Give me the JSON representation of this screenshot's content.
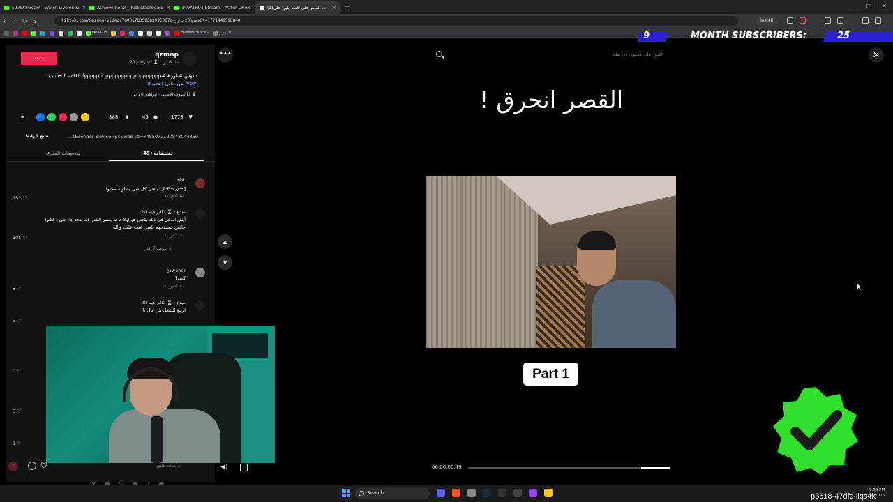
{
  "browser": {
    "tabs": [
      {
        "label": "527W Stream - Watch Live on Ki",
        "favicon_color": "#53fc18",
        "active": false
      },
      {
        "label": "Achievements - Kick Dashboard",
        "favicon_color": "#53fc18",
        "active": false
      },
      {
        "label": "iMUATH94 Stream - Watch Live o",
        "favicon_color": "#53fc18",
        "active": false
      },
      {
        "label": "(1)القصر علي 'قصر باور' علي ...",
        "favicon_color": "#ffffff",
        "active": true
      }
    ],
    "url": "tiktok.com/@qzmnp/video/7608178359683996367q=قصر%20باور&t=1771440598840",
    "install_label": "Install",
    "bookmarks": [
      "iMUATH",
      "Evanescence -",
      "البارشر"
    ]
  },
  "subscriber_banner": {
    "count_left": "9",
    "label": "MONTH SUBSCRIBERS:",
    "count_right": "25"
  },
  "post": {
    "follow_label": "متابعة",
    "author": "qzmnp",
    "author_meta": "ابراهيم 20kl ⌛ · منذ 6 س",
    "caption": "الكلمة بالحساب fypppppppppppppppppppppppp# #شوش #باور",
    "caption_tags": "#باور_ثاني_احجيه fyp#",
    "music": "♫ الصوت الأصلي - ابراهيم 20kl ⌛",
    "likes": "1773",
    "comments_count": "45",
    "saves": "388",
    "copy_link_label": "نسخ الرابط",
    "link_text": "...1&sender_device=pc&web_id=7485072120843044359"
  },
  "panel_tabs": {
    "comments": "تعليقات (45)",
    "creator_videos": "فيديوهات المبدع"
  },
  "comments": [
    {
      "user": "RGL",
      "text": "يلعني كل شي يطلونه محتوا [ステッカー]",
      "time": "منذ 6 س   رد",
      "likes": "152 ♡"
    },
    {
      "user": "ابراهيم 20kl ⌛ · مبدع",
      "text": "أيش الدخل في ذيله يلعني هو اولا قاعد ينشر الناس انه محد جاء تني و لكنوا",
      "text2": "جالس يتسمحهم يلعني عيب عليك والله",
      "time": "منذ 5 س   رد",
      "likes": "105 ♡",
      "more": "عرض 7 أكثر ⌄"
    },
    {
      "user": "Jawaher",
      "text": "كيف؟",
      "time": "منذ 6 س   رد",
      "likes": "3 ♡"
    },
    {
      "user": "ابراهيم 20kl ⌛ · مبدع",
      "text": "ارجع الشغل يلي قال نا",
      "time": "",
      "likes": "3 ♡"
    }
  ],
  "side_likes": [
    "0 ♡",
    "5 ♡",
    "1 ♡"
  ],
  "comment_input": {
    "placeholder": "إضافة تعليق..."
  },
  "search": {
    "placeholder": "العثور على محتوى ذي صلة"
  },
  "video": {
    "title": "القصر انحرق !",
    "part_label": "Part 1",
    "time": "06:00/00:49",
    "progress": 0.0
  },
  "taskbar": {
    "search_label": "Search",
    "clock_time": "9:55 PM",
    "clock_date": "2/18/2026",
    "watermark": "p3518-47dfc-liqs4k"
  },
  "colors": {
    "accent": "#e52c4c",
    "verified_badge": "#31e02a",
    "kick_green": "#53fc18"
  },
  "icons": [
    "search-icon",
    "close-icon",
    "more-icon",
    "chevron-up-icon",
    "chevron-down-icon",
    "volume-icon",
    "heart-icon",
    "comment-icon",
    "bookmark-icon",
    "share-icon",
    "verified-check-icon"
  ]
}
